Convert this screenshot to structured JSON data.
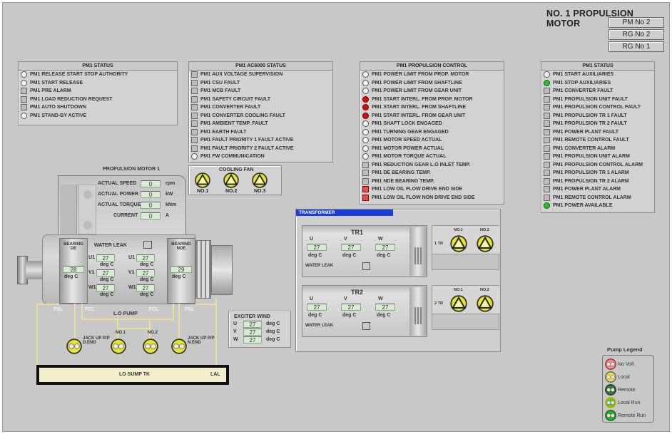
{
  "title": "NO. 1 PROPULSION MOTOR",
  "nav_buttons": [
    "PM No 2",
    "RG No 2",
    "RG No 1"
  ],
  "panels": [
    {
      "id": "pm1-status-left",
      "title": "PM1 STATUS",
      "rows": [
        {
          "label": "PM1 RELEASE START STOP AUTHORITY",
          "ind": "circle"
        },
        {
          "label": "PM1 START RELEASE",
          "ind": "circle"
        },
        {
          "label": "PM1 PRE ALARM",
          "ind": "square"
        },
        {
          "label": "PM1 LOAD REDUCTION REQUEST",
          "ind": "square"
        },
        {
          "label": "PM1 AUTO SHUTDOWN",
          "ind": "square"
        },
        {
          "label": "PM1 STAND-BY ACTIVE",
          "ind": "circle"
        }
      ]
    },
    {
      "id": "pm1-ac6000-status",
      "title": "PM1 AC6000 STATUS",
      "rows": [
        {
          "label": "PM1 AUX VOLTAGE SUPERVISION",
          "ind": "square"
        },
        {
          "label": "PM1 CSU FAULT",
          "ind": "square"
        },
        {
          "label": "PM1 MCB FAULT",
          "ind": "square"
        },
        {
          "label": "PM1 SAFETY CIRCUIT FAULT",
          "ind": "square"
        },
        {
          "label": "PM1 CONVERTER FAULT",
          "ind": "square"
        },
        {
          "label": "PM1 CONVERTER COOLING FAULT",
          "ind": "square"
        },
        {
          "label": "PM1 AMBIENT TEMP. FAULT",
          "ind": "square"
        },
        {
          "label": "PM1 EARTH FAULT",
          "ind": "square"
        },
        {
          "label": "PM1 FAULT PRIORITY 1 FAULT ACTIVE",
          "ind": "square"
        },
        {
          "label": "PM1 FAULT PRIORITY 2 FAULT ACTIVE",
          "ind": "square"
        },
        {
          "label": "PM1 FW COMMUNICATION",
          "ind": "circle"
        }
      ]
    },
    {
      "id": "pm1-propulsion-control",
      "title": "PM1 PROPULSION CONTROL",
      "rows": [
        {
          "label": "PM1 POWER LIMIT FROM PROP. MOTOR",
          "ind": "circle"
        },
        {
          "label": "PM1 POWER LIMIT FROM SHAFTLINE",
          "ind": "circle"
        },
        {
          "label": "PM1 POWER LIMIT FROM GEAR UNIT",
          "ind": "circle"
        },
        {
          "label": "PM1 START INTERL. FROM PROP. MOTOR",
          "ind": "red"
        },
        {
          "label": "PM1 START INTERL. FROM SHAFTLINE",
          "ind": "red"
        },
        {
          "label": "PM1 START INTERL. FROM GEAR UNIT",
          "ind": "red"
        },
        {
          "label": "PM1 SHAFT LOCK ENGAGED",
          "ind": "circle"
        },
        {
          "label": "PM1 TURNING GEAR ENGAGED",
          "ind": "circle"
        },
        {
          "label": "PM1 MOTOR SPEED ACTUAL",
          "ind": "circle"
        },
        {
          "label": "PM1 MOTOR POWER ACTUAL",
          "ind": "circle"
        },
        {
          "label": "PM1 MOTOR TORQUE ACTUAL",
          "ind": "circle"
        },
        {
          "label": "PM1 REDUCTION GEAR L.O INLET TEMP.",
          "ind": "square"
        },
        {
          "label": "PM1 DE BEARING TEMP.",
          "ind": "square"
        },
        {
          "label": "PM1 NDE BEARING TEMP.",
          "ind": "square"
        },
        {
          "label": "PM1 LOW OIL FLOW DRIVE END SIDE",
          "ind": "redsq"
        },
        {
          "label": "PM1 LOW OIL FLOW NON DRIVE END SIDE",
          "ind": "redsq"
        }
      ]
    },
    {
      "id": "pm1-status-right",
      "title": "PM1 STATUS",
      "rows": [
        {
          "label": "PM1 START AUXILIARIES",
          "ind": "circle"
        },
        {
          "label": "PM1 STOP AUXILIARIES",
          "ind": "green"
        },
        {
          "label": "PM1 CONVERTER FAULT",
          "ind": "square"
        },
        {
          "label": "PM1 PROPULSION UNIT FAULT",
          "ind": "square"
        },
        {
          "label": "PM1 PROPULSION CONTROL FAULT",
          "ind": "square"
        },
        {
          "label": "PM1 PROPULSION TR 1 FAULT",
          "ind": "square"
        },
        {
          "label": "PM1 PROPULSION TR 2 FAULT",
          "ind": "square"
        },
        {
          "label": "PM1 POWER PLANT FAULT",
          "ind": "square"
        },
        {
          "label": "PM1 REMOTE CONTROL FAULT",
          "ind": "square"
        },
        {
          "label": "PM1 CONVERTER ALARM",
          "ind": "square"
        },
        {
          "label": "PM1 PROPULSION UNIT ALARM",
          "ind": "square"
        },
        {
          "label": "PM1 PROPULSION CONTROL ALARM",
          "ind": "square"
        },
        {
          "label": "PM1 PROPULSION TR 1 ALARM",
          "ind": "square"
        },
        {
          "label": "PM1 PROPULSION TR 2 ALARM",
          "ind": "square"
        },
        {
          "label": "PM1 POWER PLANT ALARM",
          "ind": "square"
        },
        {
          "label": "PM1 REMOTE CONTROL ALARM",
          "ind": "square"
        },
        {
          "label": "PM1 POWER AVAILABLE",
          "ind": "green"
        }
      ]
    }
  ],
  "cooling_fan": {
    "title": "COOLING FAN",
    "fans": [
      "NO.1",
      "NO.2",
      "NO.3"
    ]
  },
  "motor": {
    "title": "PROPULSION MOTOR 1",
    "readouts": [
      {
        "label": "ACTUAL SPEED",
        "value": "0",
        "unit": "rpm"
      },
      {
        "label": "ACTUAL POWER",
        "value": "0",
        "unit": "kW"
      },
      {
        "label": "ACTUAL TORQUE",
        "value": "0",
        "unit": "kNm"
      },
      {
        "label": "CURRENT",
        "value": "0",
        "unit": "A"
      }
    ],
    "water_leak": "WATER LEAK",
    "bearing_de": {
      "label": "BEARING DE",
      "value": "28",
      "unit": "deg C"
    },
    "bearing_nde": {
      "label": "BEARING NDE",
      "value": "29",
      "unit": "deg C"
    },
    "windings_left": [
      {
        "ph": "U1",
        "value": "27",
        "unit": "deg C"
      },
      {
        "ph": "V1",
        "value": "27",
        "unit": "deg C"
      },
      {
        "ph": "W1",
        "value": "27",
        "unit": "deg C"
      }
    ],
    "windings_right": [
      {
        "ph": "U1",
        "value": "27",
        "unit": "deg C"
      },
      {
        "ph": "V1",
        "value": "27",
        "unit": "deg C"
      },
      {
        "ph": "W1",
        "value": "27",
        "unit": "deg C"
      }
    ]
  },
  "lube": {
    "psl_left": "PSL",
    "fcl_left": "FCL",
    "lo_pump": "L.O PUMP",
    "fcl_right": "FCL",
    "psl_right": "PSL",
    "pumps": [
      {
        "label": "JACK UP P/P D.END"
      },
      {
        "label": "NO.1"
      },
      {
        "label": "NO.2"
      },
      {
        "label": "JACK UP P/P N.END"
      }
    ],
    "sump": "LO SUMP TK",
    "lal": "LAL"
  },
  "exciter": {
    "title": "EXCITER WIND",
    "rows": [
      {
        "ph": "U",
        "value": "27",
        "unit": "deg C"
      },
      {
        "ph": "V",
        "value": "27",
        "unit": "deg C"
      },
      {
        "ph": "W",
        "value": "27",
        "unit": "deg C"
      }
    ]
  },
  "transformer": {
    "title": "TRANSFORMER",
    "units": [
      {
        "name": "TR1",
        "phases": [
          "U",
          "V",
          "W"
        ],
        "values": [
          "27",
          "27",
          "27"
        ],
        "unit": "deg C",
        "water_leak": "WATER LEAK",
        "fan_row": "1 TR",
        "fans": [
          "NO.1",
          "NO.2"
        ]
      },
      {
        "name": "TR2",
        "phases": [
          "U",
          "V",
          "W"
        ],
        "values": [
          "27",
          "27",
          "27"
        ],
        "unit": "deg C",
        "water_leak": "WATER LEAK",
        "fan_row": "2 TR",
        "fans": [
          "NO.1",
          "NO.2"
        ]
      }
    ]
  },
  "legend": {
    "title": "Pump Legend",
    "items": [
      {
        "label": "No Volt",
        "color": "#e89090",
        "ring": "#a02020"
      },
      {
        "label": "Local",
        "color": "#e8e040",
        "ring": "#555"
      },
      {
        "label": "Remote",
        "color": "#2e7d32",
        "ring": "#222"
      },
      {
        "label": "Local Run",
        "color": "#6cc030",
        "ring": "#c8b000"
      },
      {
        "label": "Remote Run",
        "color": "#2faa2f",
        "ring": "#145a14"
      }
    ]
  }
}
